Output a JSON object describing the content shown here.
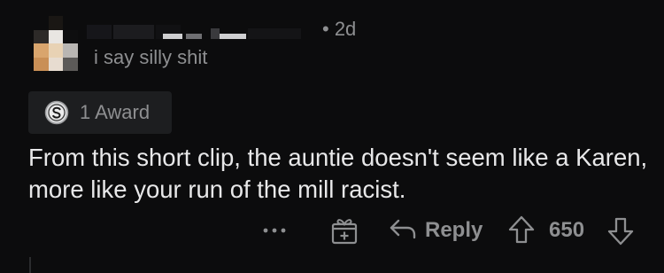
{
  "comment": {
    "timestamp_text": "• 2d",
    "flair": "i say silly shit",
    "award": {
      "icon": "silver-award-icon",
      "label": "1 Award"
    },
    "body": "From this short clip, the auntie doesn't seem like a Karen, more like your run of the mill racist.",
    "actions": {
      "more_icon": "more-horizontal-icon",
      "gift_icon": "gift-award-icon",
      "reply_icon": "reply-arrow-icon",
      "reply_label": "Reply",
      "upvote_icon": "upvote-arrow-icon",
      "score": "650",
      "downvote_icon": "downvote-arrow-icon"
    }
  },
  "colors": {
    "background": "#0c0c0d",
    "text_primary": "#e8e8e9",
    "text_muted": "#8e8f91",
    "pill_background": "#1d1e20"
  }
}
